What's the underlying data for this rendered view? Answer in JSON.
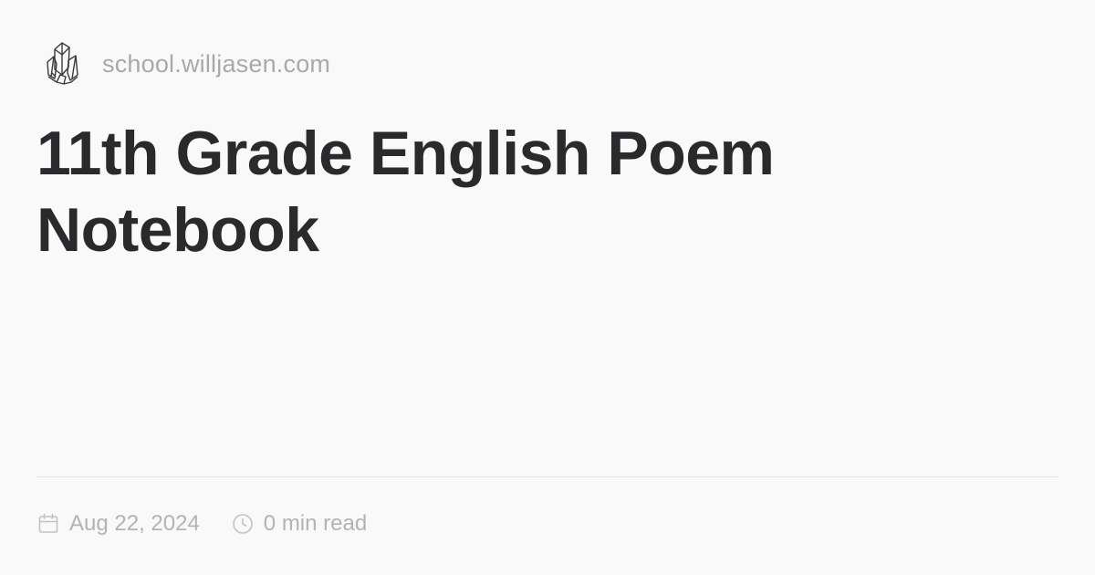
{
  "header": {
    "logo_icon": "crystal-logo-icon",
    "site_url": "school.willjasen.com"
  },
  "title_lines": [
    "11th Grade English Poem",
    "Notebook"
  ],
  "meta": {
    "date_icon": "calendar-icon",
    "date": "Aug 22, 2024",
    "read_icon": "clock-icon",
    "read_time": "0 min read"
  },
  "colors": {
    "background": "#faf9fa",
    "title": "#2a2a2c",
    "muted": "#a9a9ab",
    "divider": "#e6e5e8"
  }
}
